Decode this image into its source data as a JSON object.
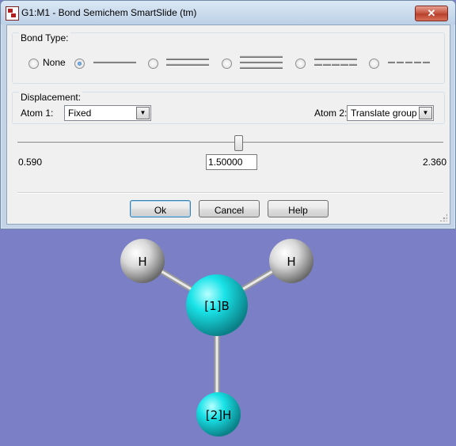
{
  "window": {
    "title": "G1:M1 - Bond Semichem SmartSlide (tm)",
    "close_glyph": "✕"
  },
  "bond_type": {
    "label": "Bond Type:",
    "options": [
      {
        "label": "None",
        "selected": false
      },
      {
        "icon": "single-bond-icon",
        "selected": true
      },
      {
        "icon": "double-bond-icon",
        "selected": false
      },
      {
        "icon": "triple-bond-icon",
        "selected": false
      },
      {
        "icon": "aromatic-bond-icon",
        "selected": false
      },
      {
        "icon": "partial-bond-icon",
        "selected": false
      }
    ]
  },
  "displacement": {
    "label": "Displacement:",
    "atom1_label": "Atom 1:",
    "atom1_value": "Fixed",
    "atom2_label": "Atom 2:",
    "atom2_value": "Translate group"
  },
  "slider": {
    "min_label": "0.590",
    "max_label": "2.360",
    "value": "1.50000",
    "fraction": 0.52
  },
  "buttons": {
    "ok": "Ok",
    "cancel": "Cancel",
    "help": "Help"
  },
  "molecule": {
    "background": "#7b7fc6",
    "atoms": [
      {
        "label": "H",
        "element": "H",
        "color": "#e6e6e6"
      },
      {
        "label": "H",
        "element": "H",
        "color": "#e6e6e6"
      },
      {
        "label": "[1]B",
        "element": "B",
        "color": "#19e3e8"
      },
      {
        "label": "[2]H",
        "element": "H",
        "color": "#19e3e8"
      }
    ]
  }
}
